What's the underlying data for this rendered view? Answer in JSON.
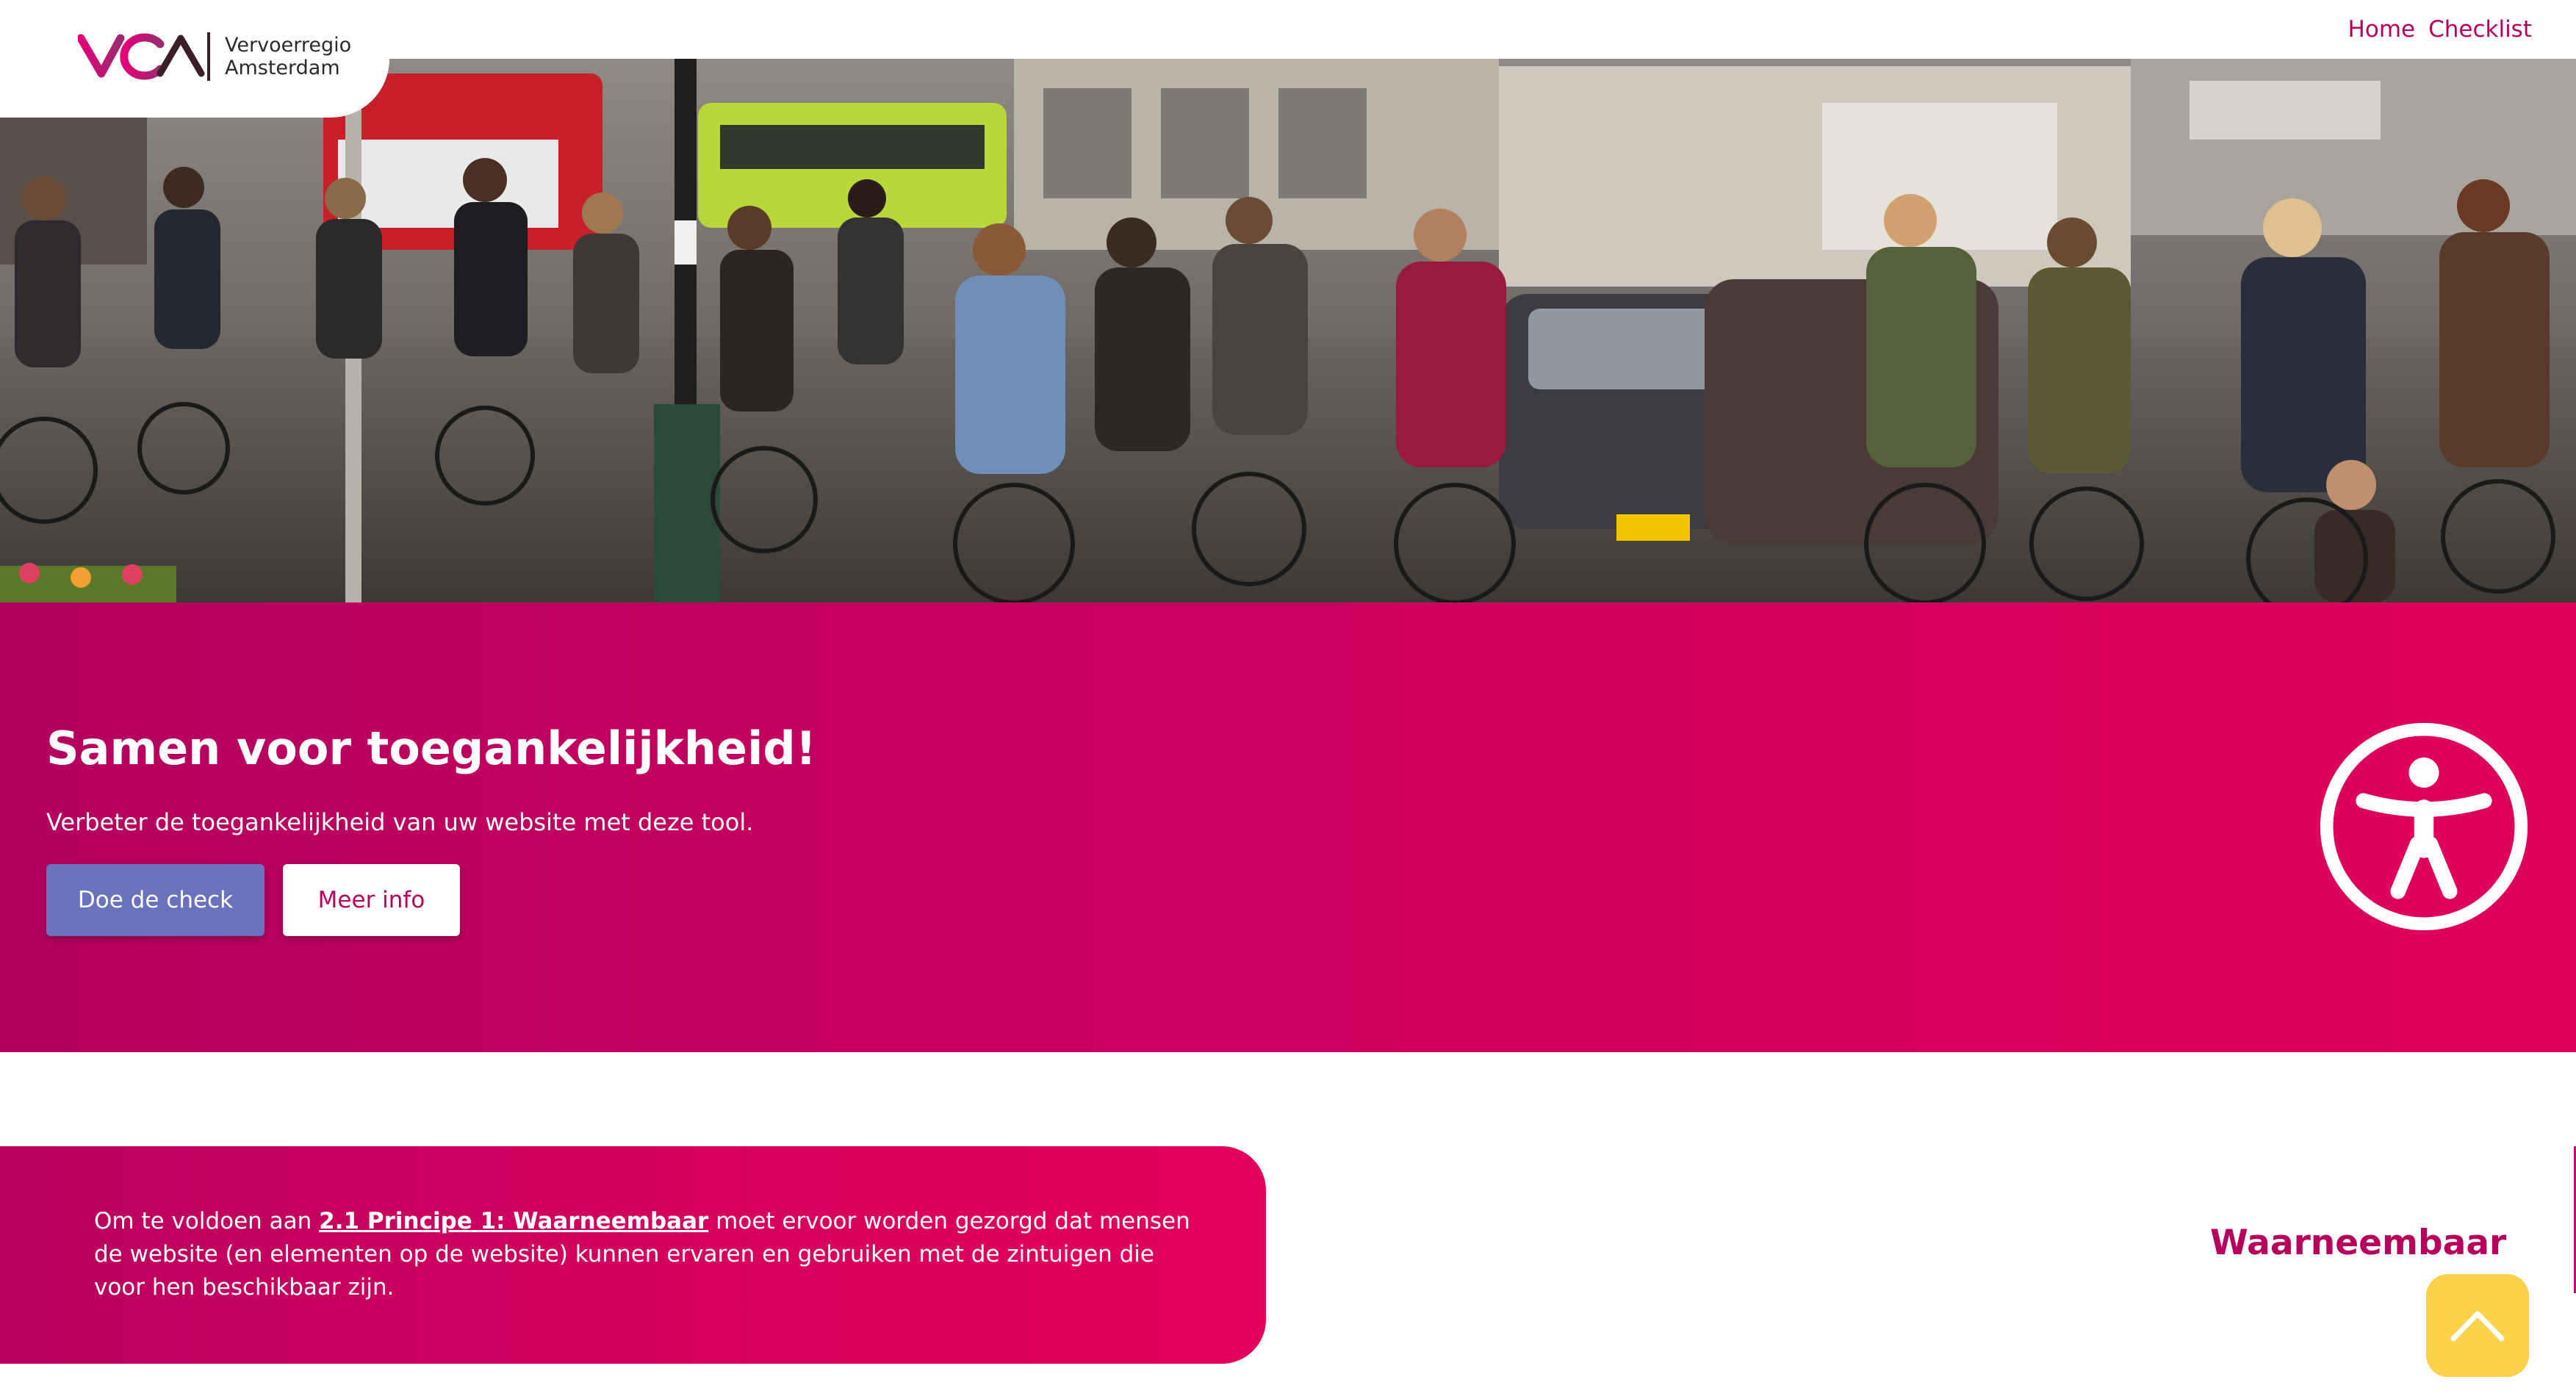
{
  "header": {
    "logo": {
      "line1": "Vervoerregio",
      "line2": "Amsterdam",
      "mark_text": "VRA"
    },
    "nav": [
      {
        "label": "Home"
      },
      {
        "label": "Checklist"
      }
    ]
  },
  "banner": {
    "title": "Samen voor toegankelijkheid!",
    "subtitle": "Verbeter de toegankelijkheid van uw website met deze tool.",
    "primary_button": "Doe de check",
    "secondary_button": "Meer info",
    "icon": "accessibility-icon"
  },
  "principle": {
    "intro": "Om te voldoen aan ",
    "link": "2.1 Principe 1: Waarneembaar",
    "rest": " moet ervoor worden gezorgd dat mensen de website (en elementen op de website) kunnen ervaren en gebruiken met de zintuigen die voor hen beschikbaar zijn.",
    "heading": "Waarneembaar"
  },
  "scroll_top": {
    "icon": "chevron-up-icon"
  },
  "colors": {
    "brand": "#b6005b",
    "banner_start": "#b3005e",
    "banner_end": "#e0005c",
    "primary_button": "#6b72bd",
    "scroll_button": "#fbd24a"
  }
}
